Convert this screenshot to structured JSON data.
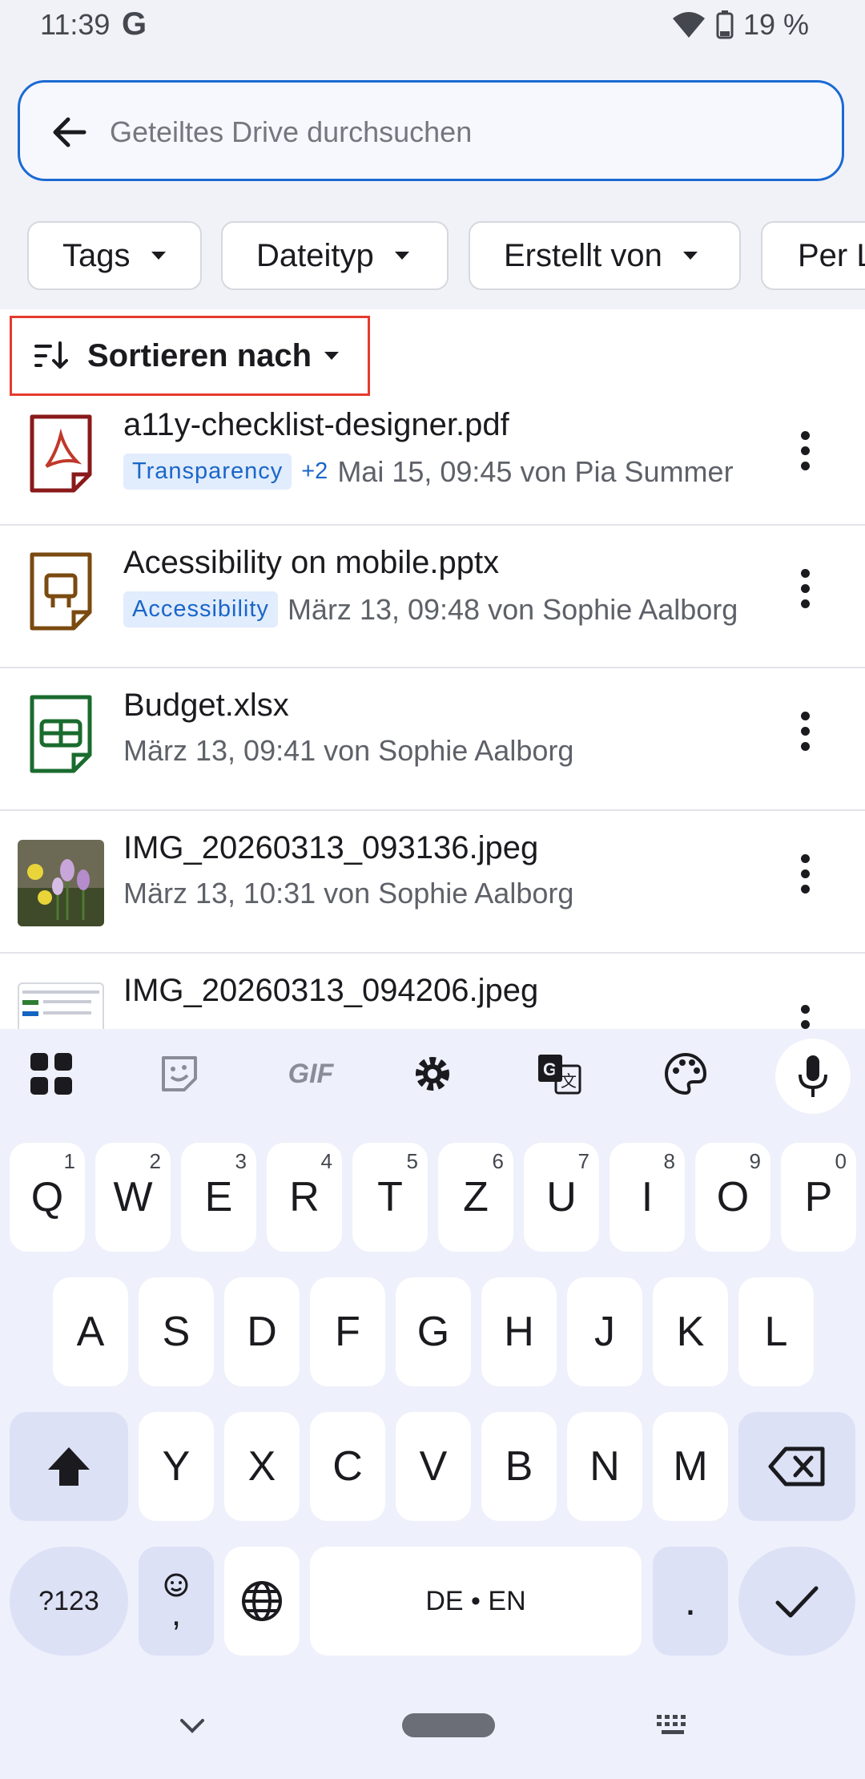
{
  "status": {
    "time": "11:39",
    "g": "G",
    "battery": "19 %"
  },
  "search": {
    "placeholder": "Geteiltes Drive durchsuchen"
  },
  "chips": [
    "Tags",
    "Dateityp",
    "Erstellt von",
    "Per L"
  ],
  "sort_label": "Sortieren nach",
  "files": [
    {
      "name": "a11y-checklist-designer.pdf",
      "tag": "Transparency",
      "extra": "+2",
      "meta": "Mai 15, 09:45 von Pia Summer",
      "type": "pdf"
    },
    {
      "name": "Acessibility on mobile.pptx",
      "tag": "Accessibility",
      "extra": "",
      "meta": "März 13, 09:48 von Sophie Aalborg",
      "type": "pptx"
    },
    {
      "name": "Budget.xlsx",
      "tag": "",
      "extra": "",
      "meta": "März 13, 09:41 von Sophie Aalborg",
      "type": "xlsx"
    },
    {
      "name": "IMG_20260313_093136.jpeg",
      "tag": "",
      "extra": "",
      "meta": "März 13, 10:31 von Sophie Aalborg",
      "type": "image"
    },
    {
      "name": "IMG_20260313_094206.jpeg",
      "tag": "",
      "extra": "",
      "meta": "",
      "type": "image2"
    }
  ],
  "keyboard": {
    "row1": [
      [
        "Q",
        "1"
      ],
      [
        "W",
        "2"
      ],
      [
        "E",
        "3"
      ],
      [
        "R",
        "4"
      ],
      [
        "T",
        "5"
      ],
      [
        "Z",
        "6"
      ],
      [
        "U",
        "7"
      ],
      [
        "I",
        "8"
      ],
      [
        "O",
        "9"
      ],
      [
        "P",
        "0"
      ]
    ],
    "row2": [
      "A",
      "S",
      "D",
      "F",
      "G",
      "H",
      "J",
      "K",
      "L"
    ],
    "row3": [
      "Y",
      "X",
      "C",
      "V",
      "B",
      "N",
      "M"
    ],
    "sym": "?123",
    "comma": ",",
    "space": "DE • EN",
    "period": ".",
    "gif": "GIF"
  },
  "colors": {
    "accent": "#1b6ad3",
    "highlight": "#e53b2c",
    "tag_bg": "#e1ecfc",
    "tag_fg": "#1a66c9"
  }
}
